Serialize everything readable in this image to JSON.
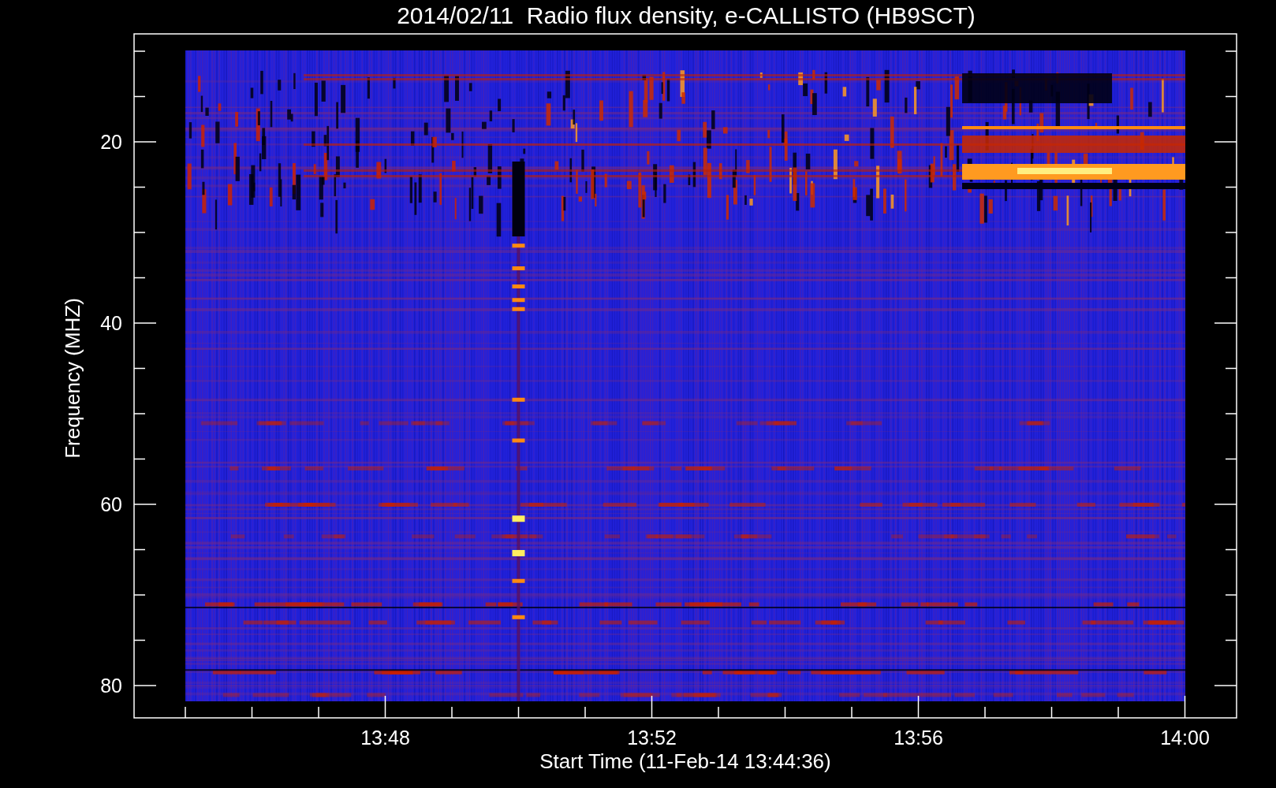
{
  "title": "2014/02/11  Radio flux density, e-CALLISTO (HB9SCT)",
  "y_axis": {
    "label": "Frequency (MHZ)",
    "ticks": [
      "20",
      "40",
      "60",
      "80"
    ]
  },
  "x_axis": {
    "label": "Start Time (11-Feb-14 13:44:36)",
    "ticks": [
      "13:48",
      "13:52",
      "13:56",
      "14:00"
    ]
  }
}
